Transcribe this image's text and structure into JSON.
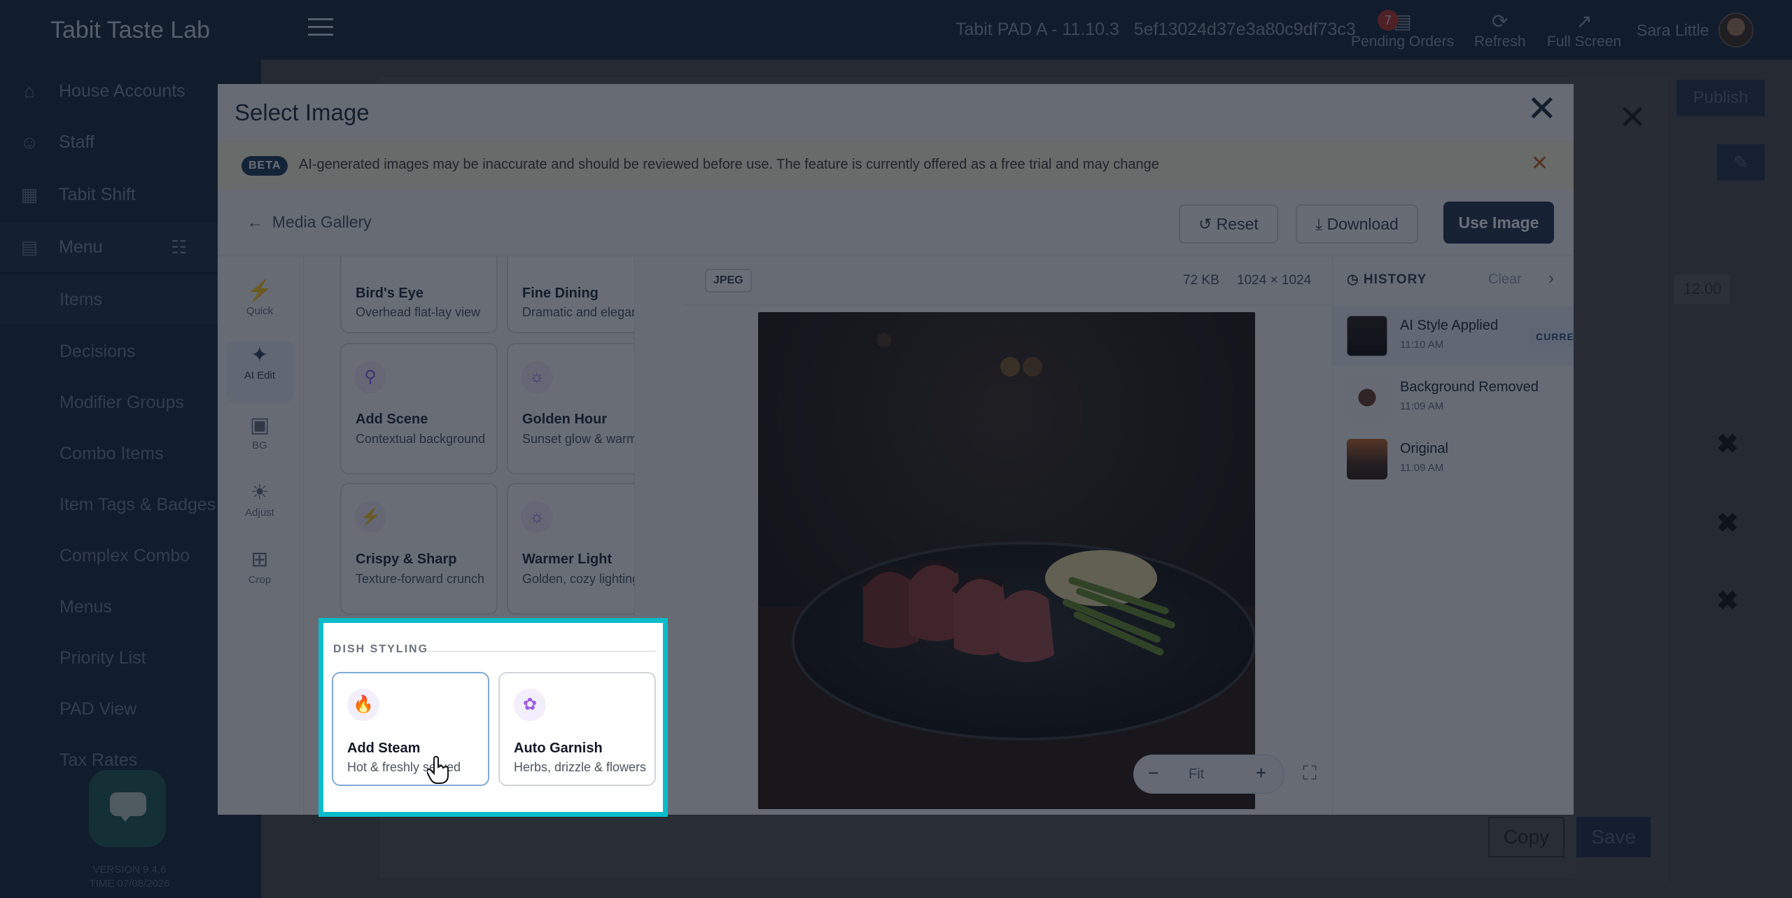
{
  "app": {
    "brand": "Tabit Taste Lab",
    "device": "Tabit PAD A - 11.10.3",
    "device_id": "5ef13024d37e3a80c9df73c3",
    "pending_orders": {
      "label": "Pending Orders",
      "count": "7"
    },
    "refresh_label": "Refresh",
    "fullscreen_label": "Full Screen",
    "user_name": "Sara Little"
  },
  "sidebar": {
    "items": [
      {
        "label": "House Accounts",
        "icon": "house-dollar-icon"
      },
      {
        "label": "Staff",
        "icon": "people-icon"
      },
      {
        "label": "Tabit Shift",
        "icon": "calendar-icon"
      },
      {
        "label": "Menu",
        "icon": "menu-book-icon"
      }
    ],
    "subitems": [
      "Items",
      "Decisions",
      "Modifier Groups",
      "Combo Items",
      "Item Tags & Badges",
      "Complex Combo",
      "Menus",
      "Priority List",
      "PAD View",
      "Tax Rates"
    ],
    "version": "VERSION 9.4.6",
    "time": "TIME 07/08/2026"
  },
  "background_page": {
    "publish_label": "Publish",
    "price": "12.00",
    "copy_label": "Copy",
    "save_label": "Save"
  },
  "modal": {
    "title": "Select Image",
    "beta": {
      "tag": "BETA",
      "text": "AI-generated images may be inaccurate and should be reviewed before use. The feature is currently offered as a free trial and may change"
    },
    "toolbar": {
      "back_label": "Media Gallery",
      "reset_label": "Reset",
      "download_label": "Download",
      "use_label": "Use Image"
    },
    "tools": [
      {
        "label": "Quick",
        "icon": "bolt-icon"
      },
      {
        "label": "AI Edit",
        "icon": "magic-wand-icon"
      },
      {
        "label": "BG",
        "icon": "image-icon"
      },
      {
        "label": "Adjust",
        "icon": "sun-icon"
      },
      {
        "label": "Crop",
        "icon": "crop-icon"
      }
    ],
    "presets": [
      {
        "title": "Bird's Eye",
        "subtitle": "Overhead flat-lay view"
      },
      {
        "title": "Fine Dining",
        "subtitle": "Dramatic and elegant"
      },
      {
        "title": "Add Scene",
        "subtitle": "Contextual background",
        "icon": "location-pin-icon"
      },
      {
        "title": "Golden Hour",
        "subtitle": "Sunset glow & warmth",
        "icon": "sunrise-icon"
      },
      {
        "title": "Crispy & Sharp",
        "subtitle": "Texture-forward crunch",
        "icon": "bolt-icon"
      },
      {
        "title": "Warmer Light",
        "subtitle": "Golden, cozy lighting",
        "icon": "sunrise-icon"
      }
    ],
    "dish_styling": {
      "label": "DISH STYLING",
      "cards": [
        {
          "title": "Add Steam",
          "subtitle": "Hot & freshly served",
          "icon": "flame-icon"
        },
        {
          "title": "Auto Garnish",
          "subtitle": "Herbs, drizzle & flowers",
          "icon": "flower-icon"
        }
      ]
    },
    "preview": {
      "format": "JPEG",
      "size": "72 KB",
      "dimensions": "1024 × 1024",
      "zoom_label": "Fit"
    },
    "history": {
      "title": "HISTORY",
      "clear_label": "Clear",
      "items": [
        {
          "title": "AI Style Applied",
          "time": "11:10 AM",
          "badge": "CURRENT"
        },
        {
          "title": "Background Removed",
          "time": "11:09 AM"
        },
        {
          "title": "Original",
          "time": "11:09 AM"
        }
      ]
    }
  },
  "colors": {
    "accent_highlight": "#0bbccb",
    "primary_button": "#22344f",
    "preset_icon": "#9b5de5"
  }
}
